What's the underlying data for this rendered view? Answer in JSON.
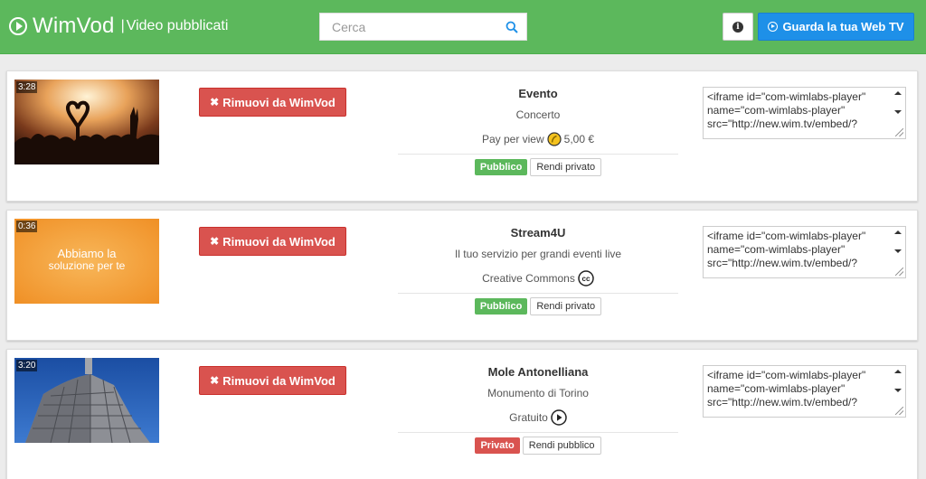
{
  "header": {
    "brand": "WimVod",
    "separator": "|",
    "subtitle": "Video pubblicati",
    "search_placeholder": "Cerca",
    "watch_label": "Guarda la tua Web TV",
    "colors": {
      "header_bg": "#5cb85c",
      "watch_btn": "#1e90e8",
      "remove_btn": "#d9534f"
    }
  },
  "videos": [
    {
      "duration": "3:28",
      "thumbnail_icon": "concert-crowd-image",
      "remove_label": "Rimuovi da WimVod",
      "title": "Evento",
      "subtitle": "Concerto",
      "license": "Pay per view",
      "license_icon": "coin-icon",
      "price": "5,00 €",
      "status": "Pubblico",
      "toggle_label": "Rendi privato",
      "embed": "<iframe id=\"com-wimlabs-player\" name=\"com-wimlabs-player\" src=\"http://new.wim.tv/embed/?"
    },
    {
      "duration": "0:36",
      "thumbnail_icon": "orange-slide-image",
      "thumb_line1": "Abbiamo la",
      "thumb_line2": "soluzione per te",
      "remove_label": "Rimuovi da WimVod",
      "title": "Stream4U",
      "subtitle": "Il tuo servizio per grandi eventi live",
      "license": "Creative Commons",
      "license_icon": "creative-commons-icon",
      "price": "",
      "status": "Pubblico",
      "toggle_label": "Rendi privato",
      "embed": "<iframe id=\"com-wimlabs-player\" name=\"com-wimlabs-player\" src=\"http://new.wim.tv/embed/?"
    },
    {
      "duration": "3:20",
      "thumbnail_icon": "mole-antonelliana-image",
      "remove_label": "Rimuovi da WimVod",
      "title": "Mole Antonelliana",
      "subtitle": "Monumento di Torino",
      "license": "Gratuito",
      "license_icon": "play-circle-icon",
      "price": "",
      "status": "Privato",
      "toggle_label": "Rendi pubblico",
      "embed": "<iframe id=\"com-wimlabs-player\" name=\"com-wimlabs-player\" src=\"http://new.wim.tv/embed/?"
    }
  ]
}
